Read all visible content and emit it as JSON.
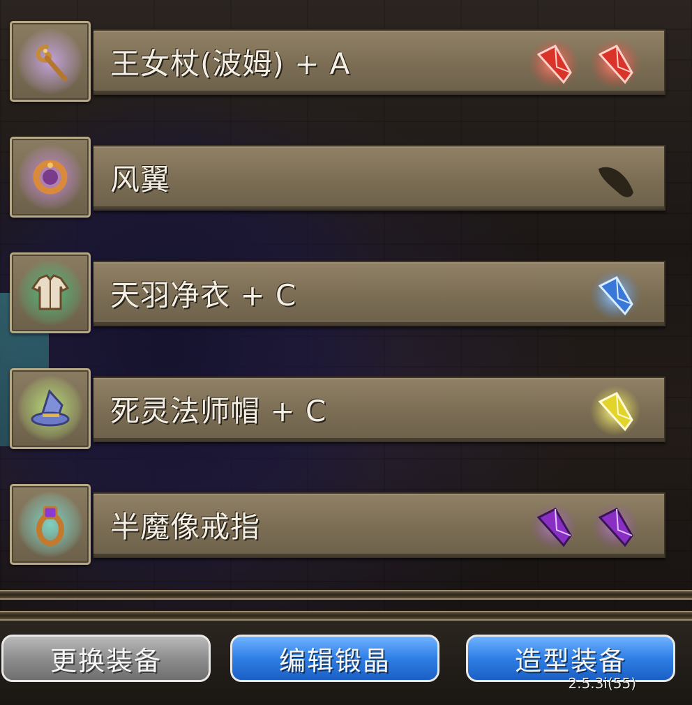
{
  "equipment": [
    {
      "slot": "weapon",
      "icon": "staff-icon",
      "icon_glow": "#c9a7e8",
      "name": "王女杖(波姆) + A",
      "gems": [
        {
          "icon": "red-crystal-icon",
          "color": "#e8463a"
        },
        {
          "icon": "red-crystal-icon",
          "color": "#e8463a"
        }
      ]
    },
    {
      "slot": "accessory",
      "icon": "wing-ring-icon",
      "icon_glow": "#c98be0",
      "name": "风翼",
      "gems": [
        {
          "icon": "dark-crystal-icon",
          "color": "#2b2418"
        }
      ]
    },
    {
      "slot": "body",
      "icon": "robe-icon",
      "icon_glow": "#4fb97a",
      "name": "天羽净衣 + C",
      "gems": [
        {
          "icon": "blue-crystal-icon",
          "color": "#4a8ee8"
        }
      ]
    },
    {
      "slot": "head",
      "icon": "wizard-hat-icon",
      "icon_glow": "#b9e07a",
      "name": "死灵法师帽 + C",
      "gems": [
        {
          "icon": "yellow-crystal-icon",
          "color": "#e8df3a"
        }
      ]
    },
    {
      "slot": "ring",
      "icon": "ring-icon",
      "icon_glow": "#7fd6c9",
      "name": "半魔像戒指",
      "gems": [
        {
          "icon": "purple-crystal-icon",
          "color": "#9a3ad0"
        },
        {
          "icon": "purple-crystal-icon",
          "color": "#9a3ad0"
        }
      ]
    }
  ],
  "buttons": {
    "change_equipment": "更换装备",
    "edit_crystals": "编辑锻晶",
    "appearance_equipment": "造型装备"
  },
  "version": "2.5.3i(55)",
  "colors": {
    "button_blue": "#2f7fe6",
    "button_gray": "#8a8a8a",
    "bar_tan": "#7b6d54"
  }
}
